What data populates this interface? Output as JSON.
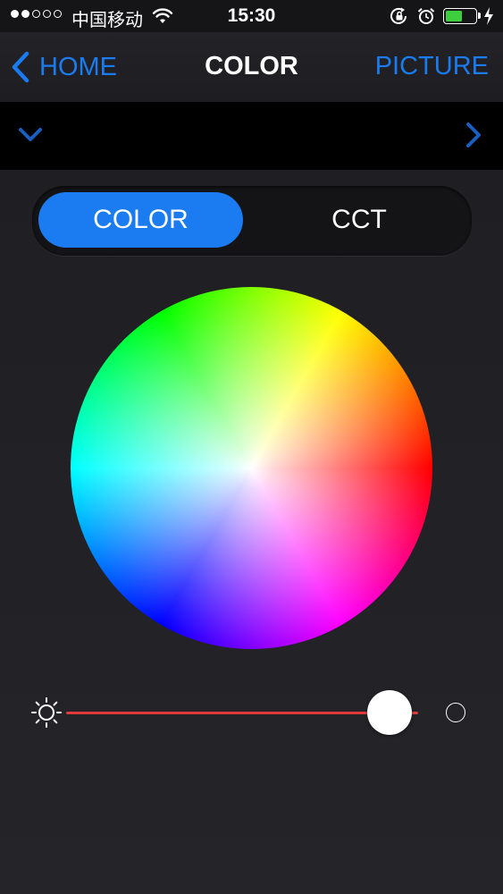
{
  "status_bar": {
    "carrier": "中国移动",
    "time": "15:30",
    "signal_filled_dots": 2,
    "signal_total_dots": 5,
    "battery_level": 0.6,
    "icons": [
      "wifi-icon",
      "rotation-lock-icon",
      "alarm-icon",
      "battery-icon",
      "charging-bolt-icon"
    ]
  },
  "nav": {
    "back_label": "HOME",
    "title": "COLOR",
    "right_label": "PICTURE"
  },
  "device_strip": {
    "icons": [
      "chevron-down-icon",
      "chevron-right-icon"
    ]
  },
  "segmented": {
    "options": [
      "COLOR",
      "CCT"
    ],
    "selected": "COLOR"
  },
  "brightness": {
    "level": 0.92,
    "icons": [
      "sun-icon",
      "off-circle-icon"
    ]
  },
  "colors": {
    "accent": "#1a7cf0",
    "slider_track": "#e23a3a",
    "background": "#1c1c20",
    "battery": "#3ecf3e"
  }
}
